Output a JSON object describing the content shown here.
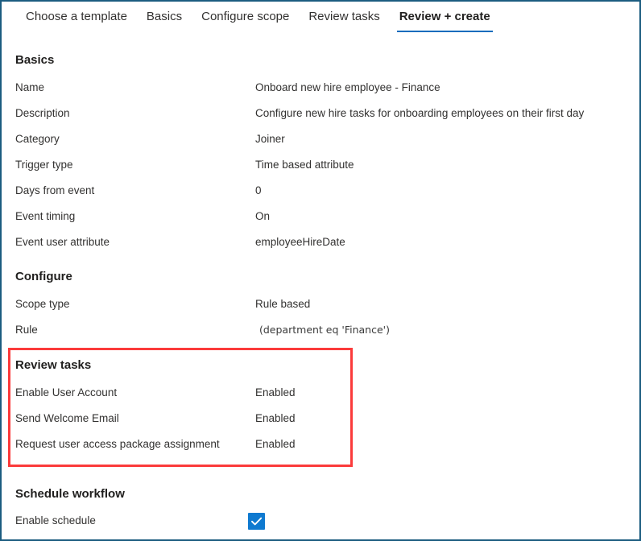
{
  "window": {
    "border_color": "#1b5c80",
    "accent_color": "#0f6cbd",
    "highlight_color": "#fb3b3b",
    "checkbox_color": "#0f7ad0"
  },
  "tabs": [
    {
      "label": "Choose a template",
      "active": false
    },
    {
      "label": "Basics",
      "active": false
    },
    {
      "label": "Configure scope",
      "active": false
    },
    {
      "label": "Review tasks",
      "active": false
    },
    {
      "label": "Review + create",
      "active": true
    }
  ],
  "sections": {
    "basics": {
      "heading": "Basics",
      "rows": [
        {
          "label": "Name",
          "value": "Onboard new hire employee - Finance"
        },
        {
          "label": "Description",
          "value": "Configure new hire tasks for onboarding employees on their first day"
        },
        {
          "label": "Category",
          "value": "Joiner"
        },
        {
          "label": "Trigger type",
          "value": "Time based attribute"
        },
        {
          "label": "Days from event",
          "value": "0"
        },
        {
          "label": "Event timing",
          "value": "On"
        },
        {
          "label": "Event user attribute",
          "value": "employeeHireDate"
        }
      ]
    },
    "configure": {
      "heading": "Configure",
      "rows": [
        {
          "label": "Scope type",
          "value": "Rule based"
        },
        {
          "label": "Rule",
          "value": "(department eq 'Finance')"
        }
      ]
    },
    "review_tasks": {
      "heading": "Review tasks",
      "highlighted": true,
      "rows": [
        {
          "label": "Enable User Account",
          "value": "Enabled"
        },
        {
          "label": "Send Welcome Email",
          "value": "Enabled"
        },
        {
          "label": "Request user access package assignment",
          "value": "Enabled"
        }
      ]
    },
    "schedule_workflow": {
      "heading": "Schedule workflow",
      "rows": [
        {
          "label": "Enable schedule",
          "value": "",
          "checkbox": true,
          "checked": true
        }
      ]
    }
  }
}
